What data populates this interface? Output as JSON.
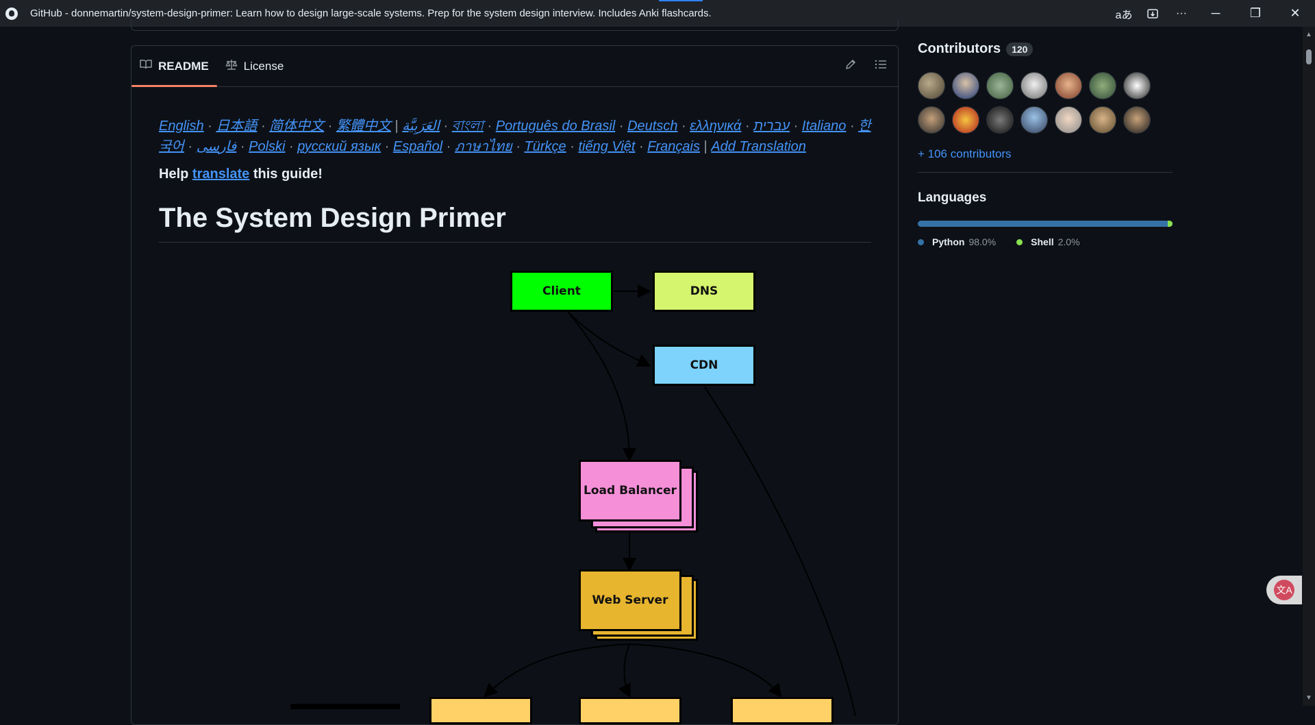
{
  "window": {
    "title": "GitHub - donnemartin/system-design-primer: Learn how to design large-scale systems. Prep for the system design interview. Includes Anki flashcards.",
    "read_aloud_icon": "aあ",
    "more_icon": "···",
    "minimize": "─",
    "restore": "❐",
    "close": "✕"
  },
  "readme": {
    "tabs": [
      {
        "label": "README",
        "icon": "book-icon"
      },
      {
        "label": "License",
        "icon": "scale-icon"
      }
    ],
    "languages": [
      "English",
      "日本語",
      "简体中文",
      "繁體中文",
      "العَرَبِيَّة",
      "বাংলা",
      "Português do Brasil",
      "Deutsch",
      "ελληνικά",
      "עברית",
      "Italiano",
      "한국어",
      "فارسی",
      "Polski",
      "русский язык",
      "Español",
      "ภาษาไทย",
      "Türkçe",
      "tiếng Việt",
      "Français",
      "Add Translation"
    ],
    "help_prefix": "Help",
    "help_link": "translate",
    "help_suffix": "this guide!",
    "heading": "The System Design Primer",
    "diagram": {
      "client": "Client",
      "dns": "DNS",
      "cdn": "CDN",
      "load_balancer": "Load Balancer",
      "web_server": "Web Server"
    }
  },
  "sidebar": {
    "contributors_title": "Contributors",
    "contributors_count": "120",
    "more_contributors": "+ 106 contributors",
    "languages_title": "Languages",
    "languages": [
      {
        "name": "Python",
        "percent": "98.0%",
        "color": "#3572a5"
      },
      {
        "name": "Shell",
        "percent": "2.0%",
        "color": "#89e051"
      }
    ]
  },
  "colors": {
    "bg": "#0d1117",
    "link": "#4493f8",
    "tab_underline": "#f78166",
    "client": "#00ff00",
    "dns": "#d6f56e",
    "cdn": "#7dd3fc",
    "load_balancer": "#f48fd8",
    "web_server": "#e7b52e"
  }
}
